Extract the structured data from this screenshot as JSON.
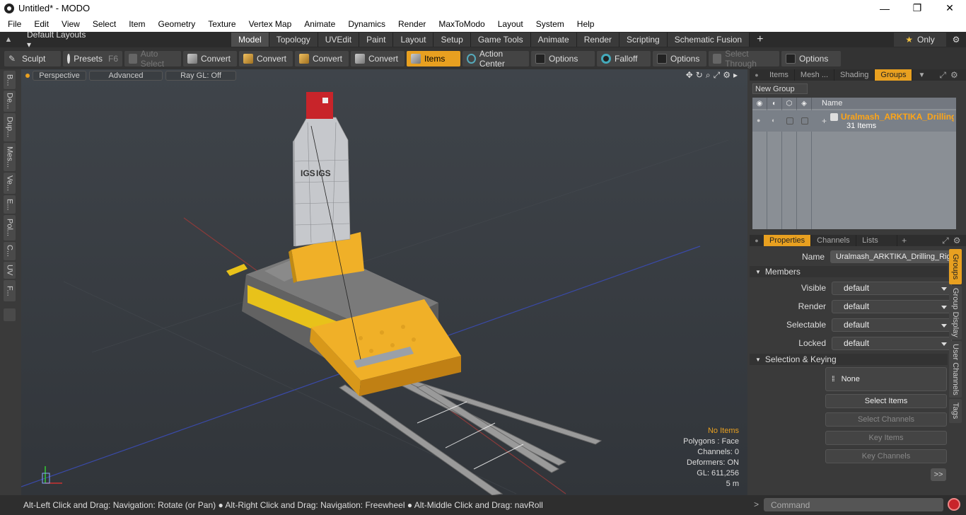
{
  "window": {
    "title": "Untitled* - MODO",
    "minimize": "—",
    "maximize": "❐",
    "close": "✕"
  },
  "menu": [
    "File",
    "Edit",
    "View",
    "Select",
    "Item",
    "Geometry",
    "Texture",
    "Vertex Map",
    "Animate",
    "Dynamics",
    "Render",
    "MaxToModo",
    "Layout",
    "System",
    "Help"
  ],
  "layout": {
    "selector": "Default Layouts ▾",
    "tabs": [
      "Model",
      "Topology",
      "UVEdit",
      "Paint",
      "Layout",
      "Setup",
      "Game Tools",
      "Animate",
      "Render",
      "Scripting",
      "Schematic Fusion"
    ],
    "active_tab": "Model",
    "plus": "+",
    "only": "Only"
  },
  "toolbar": {
    "sculpt": "Sculpt",
    "presets": "Presets",
    "presets_key": "F6",
    "auto_select": "Auto Select",
    "convert1": "Convert",
    "convert2": "Convert",
    "convert3": "Convert",
    "convert4": "Convert",
    "items": "Items",
    "action_center": "Action Center",
    "options1": "Options",
    "falloff": "Falloff",
    "options2": "Options",
    "select_through": "Select Through",
    "options3": "Options"
  },
  "left_tabs": [
    "B...",
    "De...",
    "Dup...",
    "Mes...",
    "Ve...",
    "E...",
    "Pol...",
    "C...",
    "UV",
    "F..."
  ],
  "viewport": {
    "perspective": "Perspective",
    "advanced": "Advanced",
    "raygl": "Ray GL: Off",
    "brand_text": "IGS",
    "info": {
      "no_items": "No Items",
      "polygons": "Polygons : Face",
      "channels": "Channels: 0",
      "deformers": "Deformers: ON",
      "gl": "GL: 611,256",
      "scale": "5 m"
    }
  },
  "groups_panel": {
    "tabs": [
      "Items",
      "Mesh ...",
      "Shading",
      "Groups"
    ],
    "active": "Groups",
    "new_group": "New Group",
    "name_col": "Name",
    "group_name": "Uralmash_ARKTIKA_Drilling_Rig",
    "group_count": "31 Items"
  },
  "properties": {
    "tabs": [
      "Properties",
      "Channels",
      "Lists"
    ],
    "plus": "+",
    "name_label": "Name",
    "name_value": "Uralmash_ARKTIKA_Drilling_Rig (",
    "members": "Members",
    "visible_label": "Visible",
    "visible": "default",
    "render_label": "Render",
    "render": "default",
    "selectable_label": "Selectable",
    "selectable": "default",
    "locked_label": "Locked",
    "locked": "default",
    "sel_keying": "Selection & Keying",
    "none": "None",
    "select_items": "Select Items",
    "select_channels": "Select Channels",
    "key_items": "Key Items",
    "key_channels": "Key Channels",
    "more": ">>"
  },
  "side_tabs": [
    "Groups",
    "Group Display",
    "User Channels",
    "Tags"
  ],
  "status": "Alt-Left Click and Drag: Navigation: Rotate (or Pan) ● Alt-Right Click and Drag: Navigation: Freewheel ● Alt-Middle Click and Drag: navRoll",
  "command": {
    "placeholder": "Command"
  }
}
